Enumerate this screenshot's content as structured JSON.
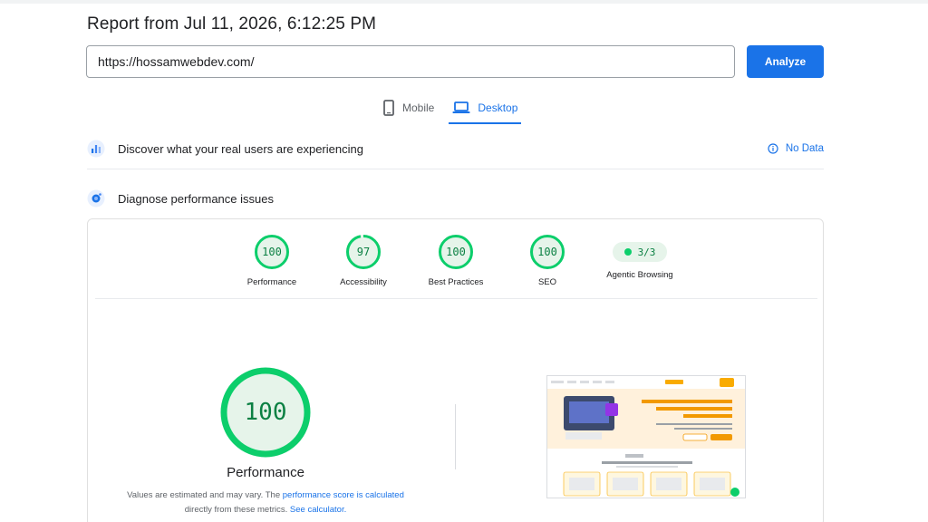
{
  "report": {
    "title": "Report from Jul 11, 2026, 6:12:25 PM"
  },
  "url_input": {
    "value": "https://hossamwebdev.com/"
  },
  "analyze_button": {
    "label": "Analyze"
  },
  "tabs": [
    {
      "label": "Mobile",
      "icon": "phone-icon",
      "active": false
    },
    {
      "label": "Desktop",
      "icon": "laptop-icon",
      "active": true
    }
  ],
  "field_data": {
    "title": "Discover what your real users are experiencing",
    "status": "No Data"
  },
  "diagnose": {
    "title": "Diagnose performance issues"
  },
  "scores": [
    {
      "label": "Performance",
      "value": "100"
    },
    {
      "label": "Accessibility",
      "value": "97"
    },
    {
      "label": "Best Practices",
      "value": "100"
    },
    {
      "label": "SEO",
      "value": "100"
    }
  ],
  "agentic": {
    "label": "Agentic Browsing",
    "value": "3/3"
  },
  "performance_panel": {
    "score": "100",
    "title": "Performance",
    "note_before": "Values are estimated and may vary. The ",
    "note_link1": "performance score is calculated",
    "note_middle": " directly from these metrics. ",
    "note_link2": "See calculator."
  },
  "colors": {
    "accent": "#1a73e8",
    "pass": "#0cce6b",
    "pass_text": "#0b8043",
    "pass_bg": "#e6f4ea"
  }
}
